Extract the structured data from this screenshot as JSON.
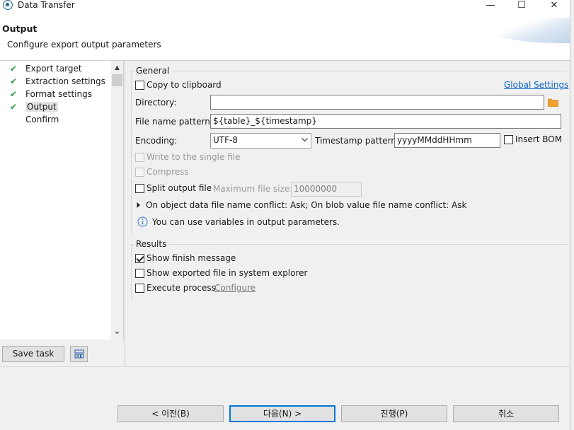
{
  "window": {
    "title": "Data Transfer",
    "minimize": "—",
    "maximize": "☐",
    "close": "✕"
  },
  "banner": {
    "title": "Output",
    "subtitle": "Configure export output parameters"
  },
  "nav": {
    "items": [
      {
        "label": "Export target",
        "checked": true
      },
      {
        "label": "Extraction settings",
        "checked": true
      },
      {
        "label": "Format settings",
        "checked": true
      },
      {
        "label": "Output",
        "checked": true,
        "selected": true
      },
      {
        "label": "Confirm",
        "checked": false
      }
    ],
    "check_glyph": "✔",
    "scroll_up": "▲",
    "scroll_down": "⌄"
  },
  "buttons": {
    "save_task": "Save task"
  },
  "general": {
    "title": "General",
    "copy_to_clipboard": "Copy to clipboard",
    "global_settings": "Global Settings",
    "directory_label": "Directory:",
    "directory_value": "",
    "file_name_pattern_label": "File name pattern:",
    "file_name_pattern_value": "${table}_${timestamp}",
    "encoding_label": "Encoding:",
    "encoding_value": "UTF-8",
    "timestamp_pattern_label": "Timestamp pattern:",
    "timestamp_pattern_value": "yyyyMMddHHmm",
    "insert_bom": "Insert BOM",
    "write_single_file": "Write to the single file",
    "compress": "Compress",
    "split_output_file": "Split output file",
    "max_file_size_label": "Maximum file size:",
    "max_file_size_value": "10000000",
    "conflict_text": "On object data file name conflict: Ask; On blob value file name conflict: Ask",
    "info_text": "You can use variables in output parameters."
  },
  "results": {
    "title": "Results",
    "show_finish_message": "Show finish message",
    "show_exported_file": "Show exported file in system explorer",
    "execute_process": "Execute process",
    "configure": "Configure"
  },
  "footer": {
    "back": "< 이전(B)",
    "next": "다음(N) >",
    "proceed": "진행(P)",
    "cancel": "취소"
  }
}
